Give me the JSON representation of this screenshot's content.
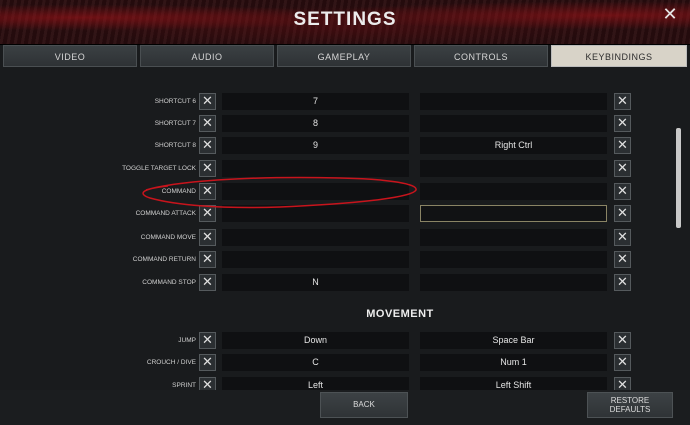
{
  "window": {
    "title": "SETTINGS",
    "close_glyph": "✕"
  },
  "tabs": [
    {
      "label": "VIDEO",
      "active": false
    },
    {
      "label": "AUDIO",
      "active": false
    },
    {
      "label": "GAMEPLAY",
      "active": false
    },
    {
      "label": "CONTROLS",
      "active": false
    },
    {
      "label": "KEYBINDINGS",
      "active": true
    }
  ],
  "clear_glyph": "✕",
  "bindings": [
    {
      "label": "SHORTCUT 6",
      "primary": "7",
      "secondary": ""
    },
    {
      "label": "SHORTCUT 7",
      "primary": "8",
      "secondary": ""
    },
    {
      "label": "SHORTCUT 8",
      "primary": "9",
      "secondary": "Right Ctrl"
    },
    {
      "label": "TOGGLE TARGET LOCK",
      "primary": "",
      "secondary": ""
    },
    {
      "label": "COMMAND",
      "primary": "",
      "secondary": ""
    },
    {
      "label": "COMMAND ATTACK",
      "primary": "",
      "secondary": ""
    },
    {
      "label": "COMMAND MOVE",
      "primary": "",
      "secondary": ""
    },
    {
      "label": "COMMAND RETURN",
      "primary": "",
      "secondary": ""
    },
    {
      "label": "COMMAND STOP",
      "primary": "N",
      "secondary": ""
    }
  ],
  "movement": {
    "heading": "MOVEMENT",
    "bindings": [
      {
        "label": "JUMP",
        "primary": "Down",
        "secondary": "Space Bar"
      },
      {
        "label": "CROUCH / DIVE",
        "primary": "C",
        "secondary": "Num 1"
      },
      {
        "label": "SPRINT",
        "primary": "Left",
        "secondary": "Left Shift"
      }
    ]
  },
  "footer": {
    "back_label": "BACK",
    "restore_line1": "RESTORE",
    "restore_line2": "DEFAULTS"
  },
  "colors": {
    "annotation": "#c8141c",
    "selected_border": "#8a8465"
  }
}
